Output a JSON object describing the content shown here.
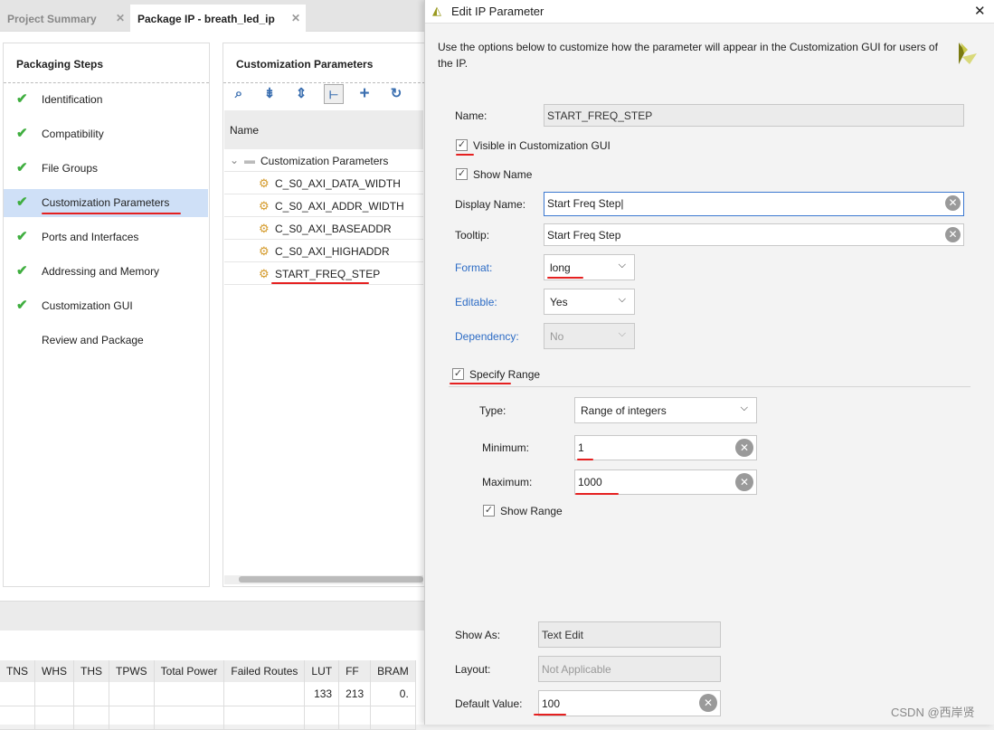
{
  "tabs": [
    {
      "label": "Project Summary",
      "active": false
    },
    {
      "label": "Package IP - breath_led_ip",
      "active": true
    }
  ],
  "steps": {
    "title": "Packaging Steps",
    "items": [
      {
        "label": "Identification",
        "done": true
      },
      {
        "label": "Compatibility",
        "done": true
      },
      {
        "label": "File Groups",
        "done": true
      },
      {
        "label": "Customization Parameters",
        "done": true,
        "selected": true
      },
      {
        "label": "Ports and Interfaces",
        "done": true
      },
      {
        "label": "Addressing and Memory",
        "done": true
      },
      {
        "label": "Customization GUI",
        "done": true
      },
      {
        "label": "Review and Package",
        "done": false
      }
    ]
  },
  "params": {
    "title": "Customization Parameters",
    "column_name": "Name",
    "group": "Customization Parameters",
    "items": [
      "C_S0_AXI_DATA_WIDTH",
      "C_S0_AXI_ADDR_WIDTH",
      "C_S0_AXI_BASEADDR",
      "C_S0_AXI_HIGHADDR",
      "START_FREQ_STEP"
    ]
  },
  "results": {
    "headers": [
      "TNS",
      "WHS",
      "THS",
      "TPWS",
      "Total Power",
      "Failed Routes",
      "LUT",
      "FF",
      "BRAM"
    ],
    "row": [
      "",
      "",
      "",
      "",
      "",
      "",
      "133",
      "213",
      "0."
    ]
  },
  "dialog": {
    "title": "Edit IP Parameter",
    "description": "Use the options below to customize how the parameter will appear in the Customization GUI for users of the IP.",
    "name_label": "Name:",
    "name_value": "START_FREQ_STEP",
    "visible_label": "Visible in Customization GUI",
    "visible_checked": true,
    "show_name_label": "Show Name",
    "show_name_checked": true,
    "display_name_label": "Display Name:",
    "display_name_value": "Start Freq Step",
    "tooltip_label": "Tooltip:",
    "tooltip_value": "Start Freq Step",
    "format_label": "Format:",
    "format_value": "long",
    "editable_label": "Editable:",
    "editable_value": "Yes",
    "dependency_label": "Dependency:",
    "dependency_value": "No",
    "specify_range_label": "Specify Range",
    "specify_range_checked": true,
    "type_label": "Type:",
    "type_value": "Range of integers",
    "minimum_label": "Minimum:",
    "minimum_value": "1",
    "maximum_label": "Maximum:",
    "maximum_value": "1000",
    "show_range_label": "Show Range",
    "show_range_checked": true,
    "show_as_label": "Show As:",
    "show_as_value": "Text Edit",
    "layout_label": "Layout:",
    "layout_value": "Not Applicable",
    "default_label": "Default Value:",
    "default_value": "100"
  },
  "watermark": "CSDN @西岸贤"
}
